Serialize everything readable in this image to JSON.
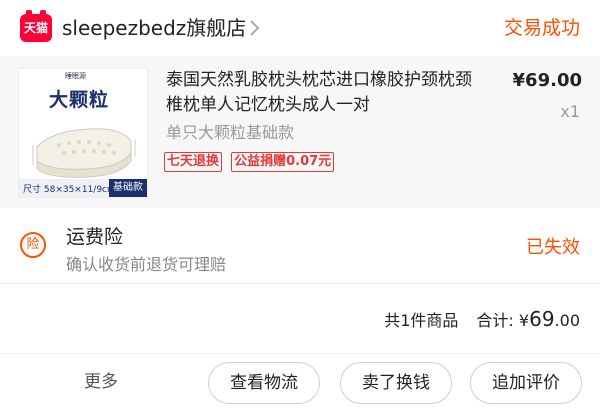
{
  "shop": {
    "logo_text": "天猫",
    "name": "sleepezbedz旗舰店",
    "status": "交易成功"
  },
  "product": {
    "image": {
      "brand": "睡眠源",
      "title": "大颗粒",
      "size_label": "尺寸 58×35×11/9cm",
      "tag": "基础款"
    },
    "title": "泰国天然乳胶枕头枕芯进口橡胶护颈枕颈椎枕单人记忆枕头成人一对",
    "sku": "单只大颗粒基础款",
    "service_tags": [
      "七天退换",
      "公益捐赠0.07元"
    ],
    "price": "¥69.00",
    "quantity": "x1"
  },
  "insurance": {
    "icon_text": "险",
    "title": "运费险",
    "description": "确认收货前退货可理赔",
    "status": "已失效"
  },
  "summary": {
    "count_text": "共1件商品",
    "total_label": "合计:",
    "currency": "¥",
    "amount_int": "69",
    "amount_dec": ".00"
  },
  "actions": {
    "more_label": "更多",
    "logistics_label": "查看物流",
    "sell_label": "卖了换钱",
    "review_label": "追加评价"
  },
  "colors": {
    "accent": "#ff5000",
    "tmall_red": "#ff0036",
    "tag_red": "#e4393c"
  }
}
